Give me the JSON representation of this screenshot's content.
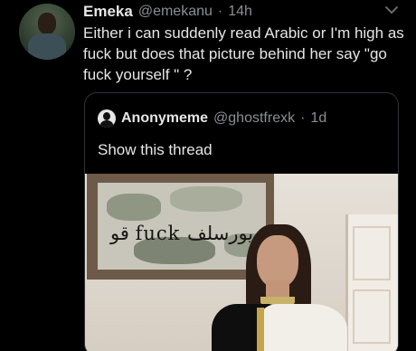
{
  "tweet": {
    "name": "Emeka",
    "handle": "@emekanu",
    "separator": "·",
    "time": "14h",
    "text": "Either i can suddenly read Arabic or I'm high as fuck but does that picture behind her say \"go fuck yourself \" ?"
  },
  "quoted": {
    "name": "Anonymeme",
    "handle": "@ghostfrexk",
    "separator": "·",
    "time": "1d",
    "show_thread": "Show this thread",
    "image_text": "قو fuck يورسلف"
  },
  "icons": {
    "menu": "chevron-down-icon",
    "avatar": "user-avatar",
    "quoted_avatar": "user-avatar"
  },
  "colors": {
    "background": "#000000",
    "primary_text": "#e6e6e6",
    "secondary_text": "#8a8f94",
    "border": "#2f3336"
  }
}
